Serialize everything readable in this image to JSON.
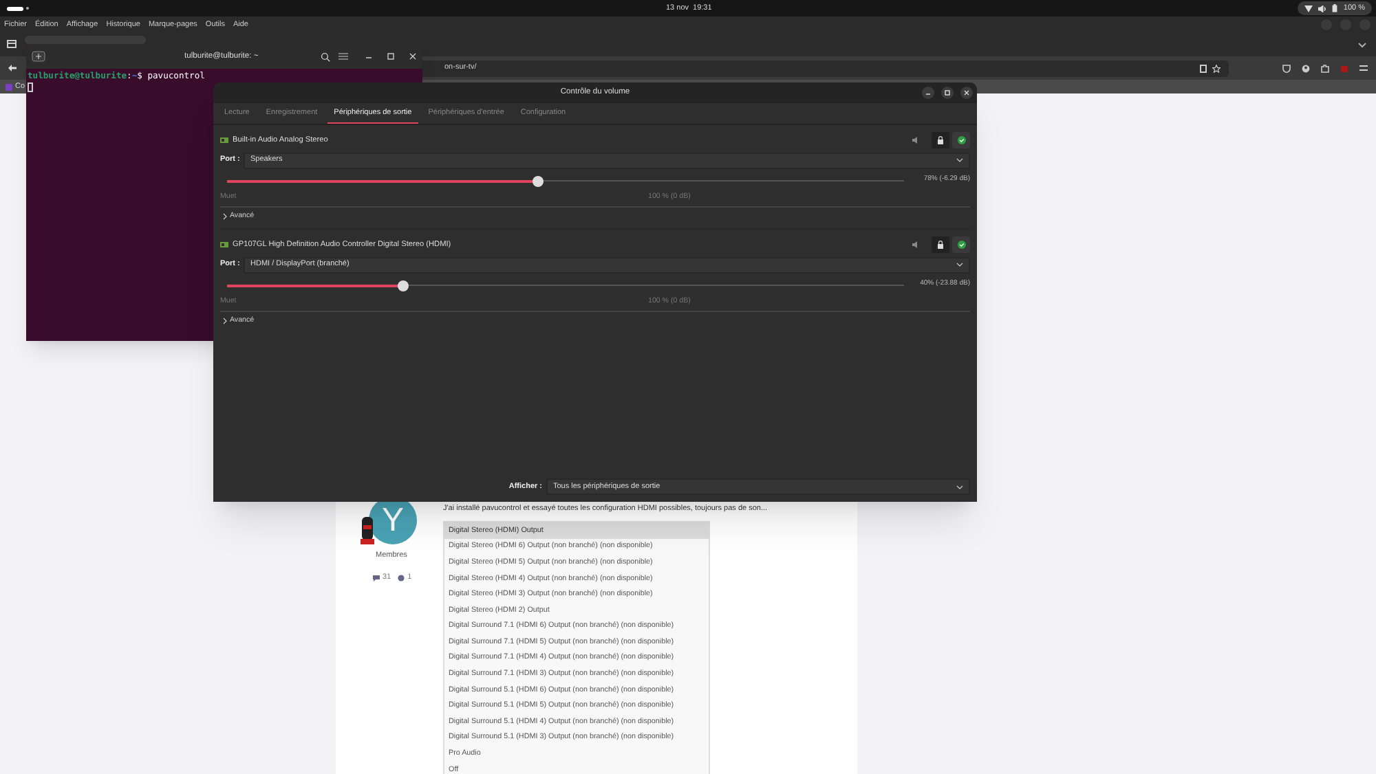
{
  "top_bar": {
    "date": "13 nov",
    "time": "19:31",
    "battery": "100 %"
  },
  "browser": {
    "menu": [
      "Fichier",
      "Édition",
      "Affichage",
      "Historique",
      "Marque-pages",
      "Outils",
      "Aide"
    ],
    "url": "on-sur-tv/",
    "bookmark": "Co"
  },
  "terminal": {
    "title": "tulburite@tulburite: ~",
    "prompt": [
      {
        "kind": "user",
        "text": "tulburite@tulburite"
      },
      {
        "kind": "plain",
        "text": ":"
      },
      {
        "kind": "path",
        "text": "~"
      },
      {
        "kind": "plain",
        "text": "$ pavucontrol"
      }
    ]
  },
  "volume_control": {
    "title": "Contrôle du volume",
    "tabs": [
      {
        "label": "Lecture",
        "selected": false
      },
      {
        "label": "Enregistrement",
        "selected": false
      },
      {
        "label": "Périphériques de sortie",
        "selected": true
      },
      {
        "label": "Périphériques d'entrée",
        "selected": false
      },
      {
        "label": "Configuration",
        "selected": false
      }
    ],
    "devices": [
      {
        "name": "Built-in Audio Analog Stereo",
        "port_label": "Port :",
        "port": "Speakers",
        "level": 0.46,
        "reading": "78% (-6.29 dB)",
        "min_label": "Muet",
        "mark_label": "100 % (0 dB)",
        "advanced": "Avancé"
      },
      {
        "name": "GP107GL High Definition Audio Controller Digital Stereo (HDMI)",
        "port_label": "Port :",
        "port": "HDMI / DisplayPort (branché)",
        "level": 0.26,
        "reading": "40% (-23.88 dB)",
        "min_label": "Muet",
        "mark_label": "100 % (0 dB)",
        "advanced": "Avancé"
      }
    ],
    "footer": {
      "label": "Afficher :",
      "value": "Tous les périphériques de sortie"
    }
  },
  "forum": {
    "post_text": "J'ai installé pavucontrol et essayé toutes les configuration HDMI possibles, toujours pas de son...",
    "avatar_letter": "Y",
    "role": "Membres",
    "posts": "31",
    "reputation": "1",
    "options": [
      {
        "label": "Digital Stereo (HDMI) Output",
        "selected": true
      },
      {
        "label": "Digital Stereo (HDMI 6) Output (non branché) (non disponible)",
        "selected": false
      },
      {
        "label": "Digital Stereo (HDMI 5) Output (non branché) (non disponible)",
        "selected": false
      },
      {
        "label": "Digital Stereo (HDMI 4) Output (non branché) (non disponible)",
        "selected": false
      },
      {
        "label": "Digital Stereo (HDMI 3) Output (non branché) (non disponible)",
        "selected": false
      },
      {
        "label": "Digital Stereo (HDMI 2) Output",
        "selected": false
      },
      {
        "label": "Digital Surround 7.1 (HDMI 6) Output (non branché) (non disponible)",
        "selected": false
      },
      {
        "label": "Digital Surround 7.1 (HDMI 5) Output (non branché) (non disponible)",
        "selected": false
      },
      {
        "label": "Digital Surround 7.1 (HDMI 4) Output (non branché) (non disponible)",
        "selected": false
      },
      {
        "label": "Digital Surround 7.1 (HDMI 3) Output (non branché) (non disponible)",
        "selected": false
      },
      {
        "label": "Digital Surround 5.1 (HDMI 6) Output (non branché) (non disponible)",
        "selected": false
      },
      {
        "label": "Digital Surround 5.1 (HDMI 5) Output (non branché) (non disponible)",
        "selected": false
      },
      {
        "label": "Digital Surround 5.1 (HDMI 4) Output (non branché) (non disponible)",
        "selected": false
      },
      {
        "label": "Digital Surround 5.1 (HDMI 3) Output (non branché) (non disponible)",
        "selected": false
      },
      {
        "label": "Pro Audio",
        "selected": false
      },
      {
        "label": "Off",
        "selected": false
      }
    ]
  }
}
